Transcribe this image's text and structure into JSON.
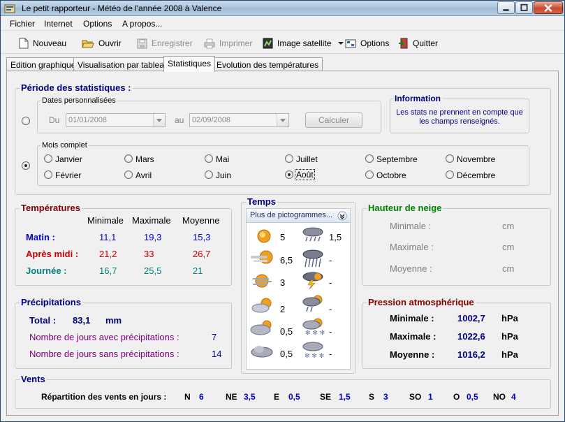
{
  "window": {
    "title": "Le petit rapporteur - Météo de l'année 2008 à Valence"
  },
  "menu": [
    "Fichier",
    "Internet",
    "Options",
    "A propos..."
  ],
  "toolbar": {
    "nouveau": "Nouveau",
    "ouvrir": "Ouvrir",
    "enregistrer": "Enregistrer",
    "imprimer": "Imprimer",
    "image_satellite": "Image satellite",
    "options": "Options",
    "quitter": "Quitter"
  },
  "tabs": [
    "Edition graphique",
    "Visualisation par tableau",
    "Statistiques",
    "Evolution des températures"
  ],
  "periode": {
    "title": "Période des statistiques :",
    "dates_title": "Dates personnalisées",
    "du_label": "Du",
    "du_value": "01/01/2008",
    "au_label": "au",
    "au_value": "02/09/2008",
    "calculer": "Calculer",
    "info_title": "Information",
    "info_text_1": "Les stats ne prennent en compte que",
    "info_text_2": "les champs renseignés.",
    "mois_title": "Mois complet",
    "months": [
      "Janvier",
      "Mars",
      "Mai",
      "Juillet",
      "Septembre",
      "Novembre",
      "Février",
      "Avril",
      "Juin",
      "Août",
      "Octobre",
      "Décembre"
    ],
    "selected_month": "Août"
  },
  "temperatures": {
    "title": "Températures",
    "headers": [
      "Minimale",
      "Maximale",
      "Moyenne"
    ],
    "rows": [
      {
        "label": "Matin :",
        "min": "11,1",
        "max": "19,3",
        "moy": "15,3",
        "color": "#0000cc"
      },
      {
        "label": "Après midi :",
        "min": "21,2",
        "max": "33",
        "moy": "26,7",
        "color": "#cc0000"
      },
      {
        "label": "Journée :",
        "min": "16,7",
        "max": "25,5",
        "moy": "21",
        "color": "#008080"
      }
    ]
  },
  "precipitations": {
    "title": "Précipitations",
    "total_label": "Total :",
    "total_value": "83,1",
    "total_unit": "mm",
    "avec_label": "Nombre de jours avec précipitations :",
    "avec_value": "7",
    "sans_label": "Nombre de jours sans précipitations :",
    "sans_value": "14"
  },
  "temps": {
    "title": "Temps",
    "dropdown": "Plus de pictogrammes...",
    "left": [
      {
        "icon": "sun-icon",
        "value": "5"
      },
      {
        "icon": "sun-haze-icon",
        "value": "6,5"
      },
      {
        "icon": "sun-wind-icon",
        "value": "3"
      },
      {
        "icon": "partly-cloudy-icon",
        "value": "2"
      },
      {
        "icon": "mostly-cloudy-icon",
        "value": "0,5"
      },
      {
        "icon": "cloudy-icon",
        "value": "0,5"
      }
    ],
    "right": [
      {
        "icon": "rain-icon",
        "value": "1,5"
      },
      {
        "icon": "heavy-rain-icon",
        "value": "-"
      },
      {
        "icon": "storm-icon",
        "value": "-"
      },
      {
        "icon": "sun-rain-icon",
        "value": "-"
      },
      {
        "icon": "sun-snow-icon",
        "value": "-"
      },
      {
        "icon": "snow-icon",
        "value": "-"
      }
    ]
  },
  "neige": {
    "title": "Hauteur de neige",
    "rows": [
      {
        "label": "Minimale :",
        "unit": "cm"
      },
      {
        "label": "Maximale :",
        "unit": "cm"
      },
      {
        "label": "Moyenne :",
        "unit": "cm"
      }
    ]
  },
  "pression": {
    "title": "Pression atmosphérique",
    "rows": [
      {
        "label": "Minimale :",
        "value": "1002,7",
        "unit": "hPa"
      },
      {
        "label": "Maximale :",
        "value": "1022,6",
        "unit": "hPa"
      },
      {
        "label": "Moyenne :",
        "value": "1016,2",
        "unit": "hPa"
      }
    ]
  },
  "vents": {
    "title": "Vents",
    "label": "Répartition des vents en jours :",
    "dirs": [
      {
        "dir": "N",
        "value": "6"
      },
      {
        "dir": "NE",
        "value": "3,5"
      },
      {
        "dir": "E",
        "value": "0,5"
      },
      {
        "dir": "SE",
        "value": "1,5"
      },
      {
        "dir": "S",
        "value": "3"
      },
      {
        "dir": "SO",
        "value": "1"
      },
      {
        "dir": "O",
        "value": "0,5"
      },
      {
        "dir": "NO",
        "value": "4"
      }
    ]
  },
  "colors": {
    "title_blue": "#000080",
    "green_title": "#008000",
    "maroon_title": "#800000",
    "value_blue": "#0000cc",
    "purple": "#800080",
    "gray": "#808080"
  }
}
